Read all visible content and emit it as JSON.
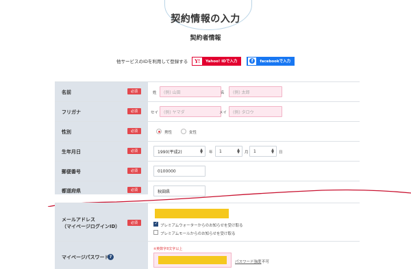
{
  "header": {
    "title": "契約情報の入力",
    "subtitle": "契約者情報"
  },
  "social": {
    "prompt": "他サービスのIDを利用して登録する",
    "yahoo_label": "Yahoo! IDで入力",
    "yahoo_logo": "Y!",
    "facebook_label": "facebookで入力",
    "facebook_logo": "f"
  },
  "required_badge": "必須",
  "form": {
    "name": {
      "label": "名前",
      "last_prefix": "姓",
      "last_placeholder": "(例) 山田",
      "first_prefix": "名",
      "first_placeholder": "(例) 太郎"
    },
    "furigana": {
      "label": "フリガナ",
      "last_prefix": "セイ",
      "last_placeholder": "(例) ヤマダ",
      "first_prefix": "メイ",
      "first_placeholder": "(例) タロウ"
    },
    "gender": {
      "label": "性別",
      "options": [
        "男性",
        "女性"
      ],
      "selected": "男性"
    },
    "birthdate": {
      "label": "生年月日",
      "year": "1990(平成2)",
      "year_unit": "年",
      "month": "1",
      "month_unit": "月",
      "day": "1",
      "day_unit": "日"
    },
    "postal": {
      "label": "郵便番号",
      "value": "0100000"
    },
    "prefecture": {
      "label": "都道府県",
      "value": "秋田県"
    }
  },
  "form2": {
    "email": {
      "label_line1": "メールアドレス",
      "label_line2": "（マイページログインID）",
      "opt1": "プレミアムウォーターからのお知らせを受け取る",
      "opt1_checked": true,
      "opt2": "プレミアムモールからのお知らせを受け取る",
      "opt2_checked": false
    },
    "password": {
      "label": "マイページパスワード",
      "help": "?",
      "hint": "※英数字8文字以上",
      "strength_label": "パスワード強度",
      "strength_value": "不可"
    }
  },
  "colors": {
    "accent": "#e3484d",
    "yahoo": "#e2002f",
    "facebook": "#1877f2",
    "tear_line": "#c8102e",
    "highlight": "#f5c81e"
  }
}
